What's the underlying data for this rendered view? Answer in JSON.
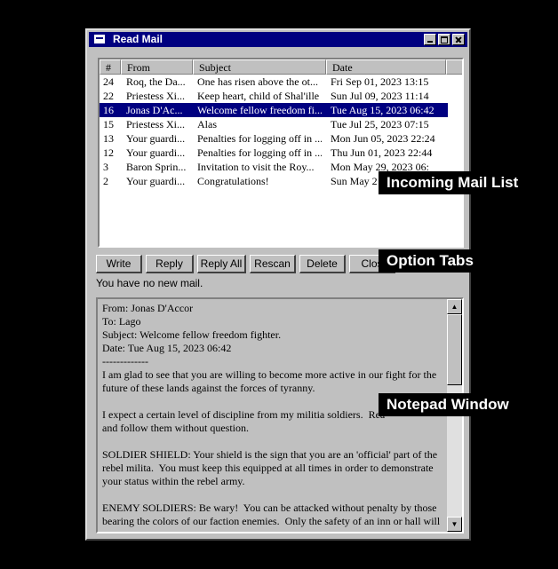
{
  "window": {
    "title": "Read Mail"
  },
  "columns": [
    "#",
    "From",
    "Subject",
    "Date"
  ],
  "messages": [
    {
      "num": "24",
      "from": "Roq, the Da...",
      "subject": "One has risen above the ot...",
      "date": "Fri Sep 01, 2023 13:15",
      "selected": false
    },
    {
      "num": "22",
      "from": "Priestess Xi...",
      "subject": "Keep heart, child of Shal'ille",
      "date": "Sun Jul 09, 2023 11:14",
      "selected": false
    },
    {
      "num": "16",
      "from": "Jonas D'Ac...",
      "subject": "Welcome fellow freedom fi...",
      "date": "Tue Aug 15, 2023 06:42",
      "selected": true
    },
    {
      "num": "15",
      "from": "Priestess Xi...",
      "subject": "Alas",
      "date": "Tue Jul 25, 2023 07:15",
      "selected": false
    },
    {
      "num": "13",
      "from": "Your guardi...",
      "subject": "Penalties for logging off in ...",
      "date": "Mon Jun 05, 2023 22:24",
      "selected": false
    },
    {
      "num": "12",
      "from": "Your guardi...",
      "subject": "Penalties for logging off in ...",
      "date": "Thu Jun 01, 2023 22:44",
      "selected": false
    },
    {
      "num": "3",
      "from": "Baron Sprin...",
      "subject": "Invitation to visit the Roy...",
      "date": "Mon May 29, 2023 06:",
      "selected": false
    },
    {
      "num": "2",
      "from": "Your guardi...",
      "subject": "Congratulations!",
      "date": "Sun May 2",
      "selected": false
    }
  ],
  "buttons": {
    "write": "Write",
    "reply": "Reply",
    "reply_all": "Reply All",
    "rescan": "Rescan",
    "delete": "Delete",
    "close": "Clos"
  },
  "status": "You have no new mail.",
  "message_body": "From: Jonas D'Accor\nTo: Lago\nSubject: Welcome fellow freedom fighter.\nDate: Tue Aug 15, 2023 06:42\n-------------\nI am glad to see that you are willing to become more active in our fight for the future of these lands against the forces of tyranny.\n\nI expect a certain level of discipline from my militia soldiers.  Rea\nand follow them without question.\n\nSOLDIER SHIELD: Your shield is the sign that you are an 'official' part of the rebel milita.  You must keep this equipped at all times in order to demonstrate your status within the rebel army.\n\nENEMY SOLDIERS: Be wary!  You can be attacked without penalty by those bearing the colors of our faction enemies.  Only the safety of an inn or hall will",
  "icons": {
    "system": "mail-window-icon",
    "minimize": "minimize-icon",
    "maximize": "maximize-icon",
    "close": "close-icon",
    "scroll_up": "arrow-up-icon",
    "scroll_down": "arrow-down-icon"
  },
  "annotations": {
    "mail_list": "Incoming Mail List",
    "option_tabs": "Option Tabs",
    "notepad": "Notepad Window"
  }
}
